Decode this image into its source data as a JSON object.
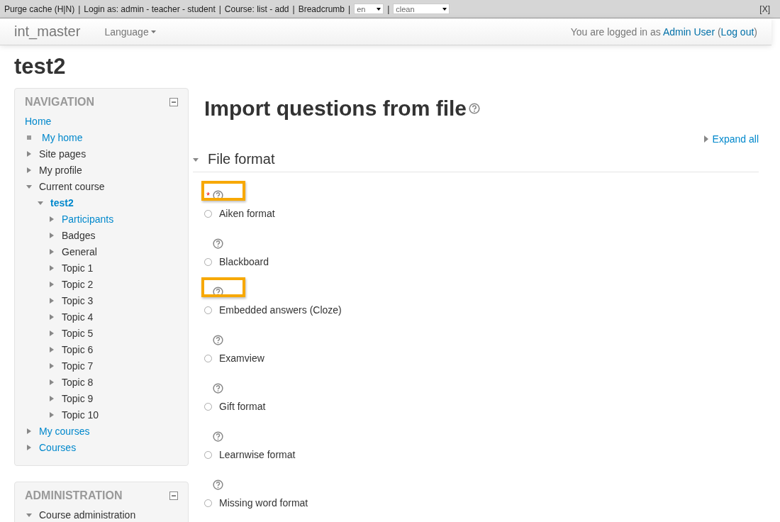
{
  "devbar": {
    "items": [
      {
        "text": "Purge cache (H|N)"
      },
      {
        "text": "Login as: admin - teacher - student"
      },
      {
        "text": "Course: list - add"
      },
      {
        "text": "Breadcrumb"
      }
    ],
    "separator": "|",
    "selects": [
      "en",
      "clean"
    ],
    "close": "[X]"
  },
  "navbar": {
    "brand": "int_master",
    "menu": "Language",
    "login_text": "You are logged in as",
    "user": "Admin User",
    "logout": "Log out",
    "logout_open": "(",
    "logout_close": ")"
  },
  "page_title": "test2",
  "navigation": {
    "title": "NAVIGATION",
    "items": [
      {
        "label": "Home",
        "kind": "plain",
        "link": true
      },
      {
        "label": "My home",
        "kind": "leaf",
        "link": true
      },
      {
        "label": "Site pages",
        "kind": "branch",
        "expanded": false,
        "link": false
      },
      {
        "label": "My profile",
        "kind": "branch",
        "expanded": false,
        "link": false
      },
      {
        "label": "Current course",
        "kind": "branch",
        "expanded": true,
        "link": false,
        "children": [
          {
            "label": "test2",
            "kind": "branch",
            "expanded": true,
            "link": true,
            "current": true,
            "children": [
              {
                "label": "Participants",
                "kind": "branch",
                "expanded": false,
                "link": true
              },
              {
                "label": "Badges",
                "kind": "branch",
                "expanded": false,
                "link": false
              },
              {
                "label": "General",
                "kind": "branch",
                "expanded": false,
                "link": false
              },
              {
                "label": "Topic 1",
                "kind": "branch",
                "expanded": false,
                "link": false
              },
              {
                "label": "Topic 2",
                "kind": "branch",
                "expanded": false,
                "link": false
              },
              {
                "label": "Topic 3",
                "kind": "branch",
                "expanded": false,
                "link": false
              },
              {
                "label": "Topic 4",
                "kind": "branch",
                "expanded": false,
                "link": false
              },
              {
                "label": "Topic 5",
                "kind": "branch",
                "expanded": false,
                "link": false
              },
              {
                "label": "Topic 6",
                "kind": "branch",
                "expanded": false,
                "link": false
              },
              {
                "label": "Topic 7",
                "kind": "branch",
                "expanded": false,
                "link": false
              },
              {
                "label": "Topic 8",
                "kind": "branch",
                "expanded": false,
                "link": false
              },
              {
                "label": "Topic 9",
                "kind": "branch",
                "expanded": false,
                "link": false
              },
              {
                "label": "Topic 10",
                "kind": "branch",
                "expanded": false,
                "link": false
              }
            ]
          }
        ]
      },
      {
        "label": "My courses",
        "kind": "branch",
        "expanded": false,
        "link": true
      },
      {
        "label": "Courses",
        "kind": "branch",
        "expanded": false,
        "link": true
      }
    ]
  },
  "administration": {
    "title": "ADMINISTRATION",
    "items": [
      {
        "label": "Course administration",
        "kind": "branch",
        "expanded": true,
        "link": false
      }
    ]
  },
  "main": {
    "title": "Import questions from file",
    "required_mark": "*",
    "expand_all": "Expand all",
    "section": {
      "title": "File format",
      "expanded": true
    },
    "formats": [
      {
        "label": "Aiken format",
        "required": true,
        "highlighted": true,
        "selected": false
      },
      {
        "label": "Blackboard",
        "required": false,
        "highlighted": false,
        "selected": false
      },
      {
        "label": "Embedded answers (Cloze)",
        "required": false,
        "highlighted": true,
        "selected": false
      },
      {
        "label": "Examview",
        "required": false,
        "highlighted": false,
        "selected": false
      },
      {
        "label": "Gift format",
        "required": false,
        "highlighted": false,
        "selected": false
      },
      {
        "label": "Learnwise format",
        "required": false,
        "highlighted": false,
        "selected": false
      },
      {
        "label": "Missing word format",
        "required": false,
        "highlighted": false,
        "selected": false
      }
    ]
  }
}
